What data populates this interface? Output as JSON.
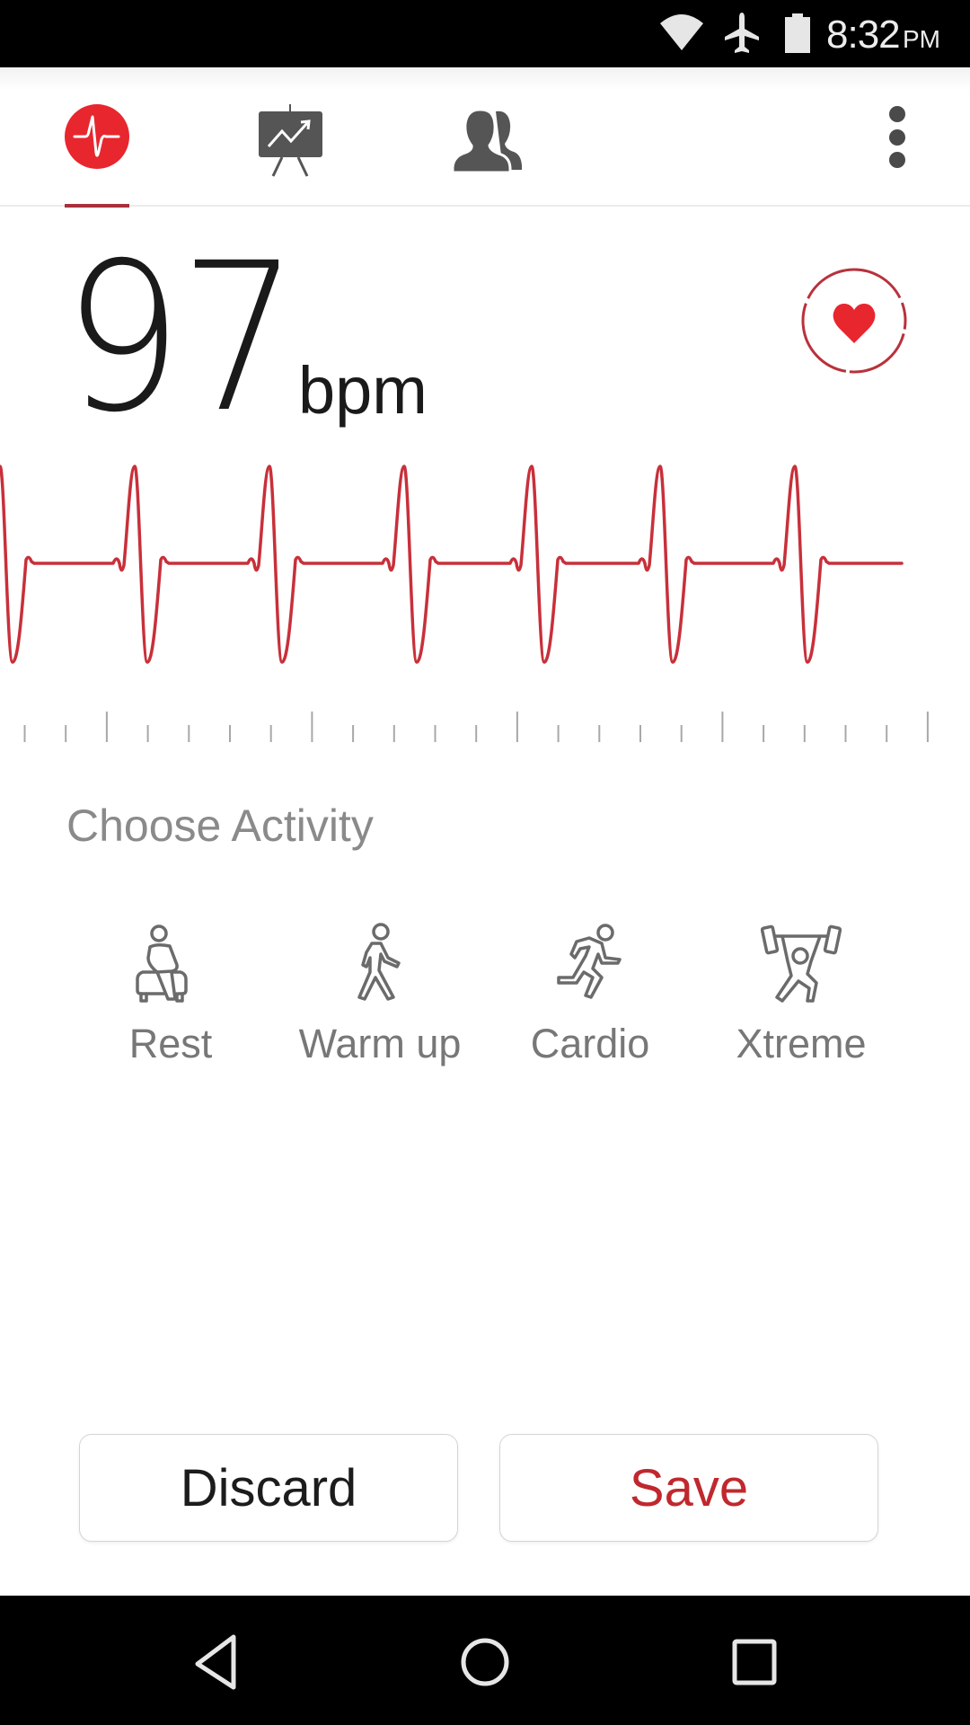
{
  "status_bar": {
    "time": "8:32",
    "ampm": "PM",
    "icons": [
      "wifi-icon",
      "airplane-mode-icon",
      "battery-icon"
    ]
  },
  "app_bar": {
    "tabs": [
      {
        "name": "heart-rate",
        "icon": "heartbeat-pulse-icon",
        "active": true
      },
      {
        "name": "history",
        "icon": "trend-chart-easel-icon",
        "active": false
      },
      {
        "name": "community",
        "icon": "people-icon",
        "active": false
      }
    ],
    "menu_icon": "more-vert-icon"
  },
  "reading": {
    "value": "97",
    "unit": "bpm",
    "heart_button_icon": "heart-icon"
  },
  "colors": {
    "accent": "#e8262e",
    "accent_dark": "#c0282e",
    "waveform": "#c8303a",
    "tab_icon": "#555555",
    "muted_text": "#8a8a8a"
  },
  "activity": {
    "heading": "Choose Activity",
    "options": [
      {
        "label": "Rest",
        "icon": "sitting-person-icon"
      },
      {
        "label": "Warm up",
        "icon": "walking-person-icon"
      },
      {
        "label": "Cardio",
        "icon": "running-person-icon"
      },
      {
        "label": "Xtreme",
        "icon": "weightlifting-person-icon"
      }
    ]
  },
  "actions": {
    "discard_label": "Discard",
    "save_label": "Save"
  },
  "nav_bar": {
    "items": [
      "back-icon",
      "home-icon",
      "recents-icon"
    ]
  }
}
